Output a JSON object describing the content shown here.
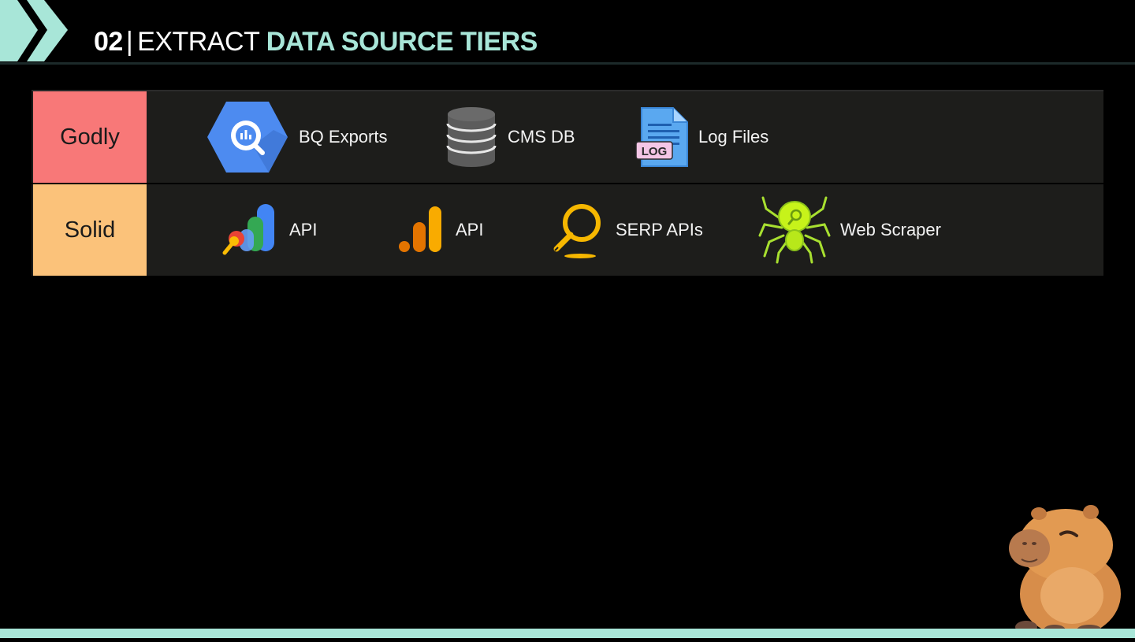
{
  "header": {
    "number": "02",
    "separator": "|",
    "plain": "EXTRACT",
    "accent": "DATA SOURCE TIERS"
  },
  "colors": {
    "accent": "#a8e6d8",
    "godly": "#f87878",
    "solid": "#fbc27a",
    "row_bg": "#1d1d1b"
  },
  "tiers": [
    {
      "label": "Godly",
      "items": [
        {
          "icon": "bigquery-icon",
          "label": "BQ Exports"
        },
        {
          "icon": "database-icon",
          "label": "CMS DB"
        },
        {
          "icon": "log-file-icon",
          "label": "Log Files"
        }
      ]
    },
    {
      "label": "Solid",
      "items": [
        {
          "icon": "looker-studio-icon",
          "label": "API"
        },
        {
          "icon": "google-analytics-icon",
          "label": "API"
        },
        {
          "icon": "magnifier-icon",
          "label": "SERP APIs"
        },
        {
          "icon": "spider-icon",
          "label": "Web Scraper"
        }
      ]
    }
  ],
  "mascot": {
    "icon": "capybara-mascot-icon"
  }
}
